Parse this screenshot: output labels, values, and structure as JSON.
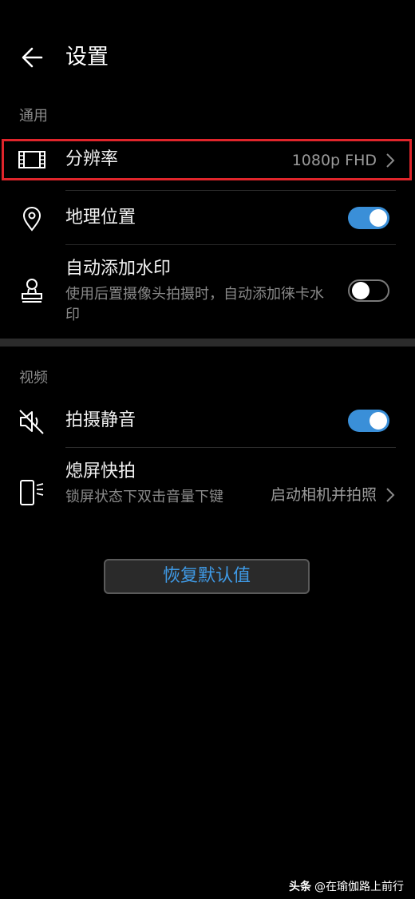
{
  "header": {
    "title": "设置",
    "back_icon": "back-arrow-icon"
  },
  "sections": {
    "general": "通用",
    "video": "视频"
  },
  "resolution": {
    "label": "分辨率",
    "value": "1080p FHD",
    "icon": "film-icon"
  },
  "location": {
    "label": "地理位置",
    "toggle": "on",
    "icon": "location-pin-icon"
  },
  "watermark_setting": {
    "label": "自动添加水印",
    "sub": "使用后置摄像头拍摄时，自动添加徕卡水印",
    "toggle": "off",
    "icon": "stamp-icon"
  },
  "mute": {
    "label": "拍摄静音",
    "toggle": "on",
    "icon": "speaker-mute-icon"
  },
  "quick_snap": {
    "label": "熄屏快拍",
    "sub": "锁屏状态下双击音量下键",
    "value": "启动相机并拍照",
    "icon": "phone-side-key-icon"
  },
  "reset_button": "恢复默认值",
  "footer_watermark": {
    "brand": "头条",
    "author": "@在瑜伽路上前行"
  },
  "colors": {
    "accent": "#3a8fd8",
    "highlight_border": "#e0252b",
    "background": "#000000"
  }
}
